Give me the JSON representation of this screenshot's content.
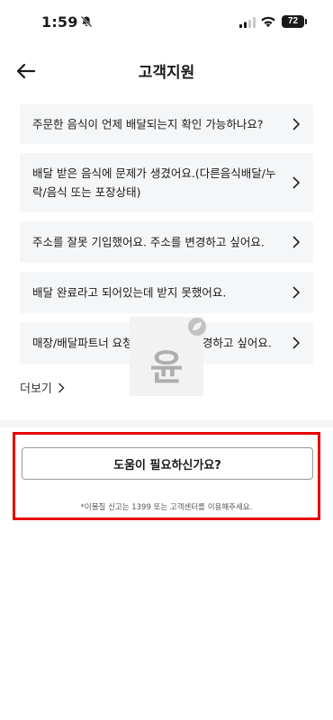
{
  "status_bar": {
    "time": "1:59",
    "battery": "72",
    "icons": [
      "bell-slash-icon",
      "signal-icon",
      "wifi-icon",
      "battery-icon"
    ]
  },
  "header": {
    "title": "고객지원",
    "back_icon": "arrow-left-icon"
  },
  "faq": {
    "items": [
      {
        "label": "주문한 음식이 언제 배달되는지 확인 가능하나요?"
      },
      {
        "label": "배달 받은 음식에 문제가 생겼어요.(다른음식배달/누락/음식 또는 포장상태)"
      },
      {
        "label": "주소를 잘못 기입했어요. 주소를 변경하고 싶어요."
      },
      {
        "label": "배달 완료라고 되어있는데 받지 못했어요."
      },
      {
        "label": "매장/배달파트너 요청사항을 등록/변경하고 싶어요."
      }
    ],
    "chevron_icon": "chevron-right-icon"
  },
  "more": {
    "label": "더보기"
  },
  "watermark": {
    "glyph": "윤"
  },
  "help": {
    "button_label": "도움이 필요하신가요?",
    "note": "*이물질 신고는 1399 또는 고객센터를 이용해주세요."
  },
  "colors": {
    "highlight_border": "#e60000",
    "card_background": "#f5f6f7",
    "text": "#1a1a1a"
  }
}
